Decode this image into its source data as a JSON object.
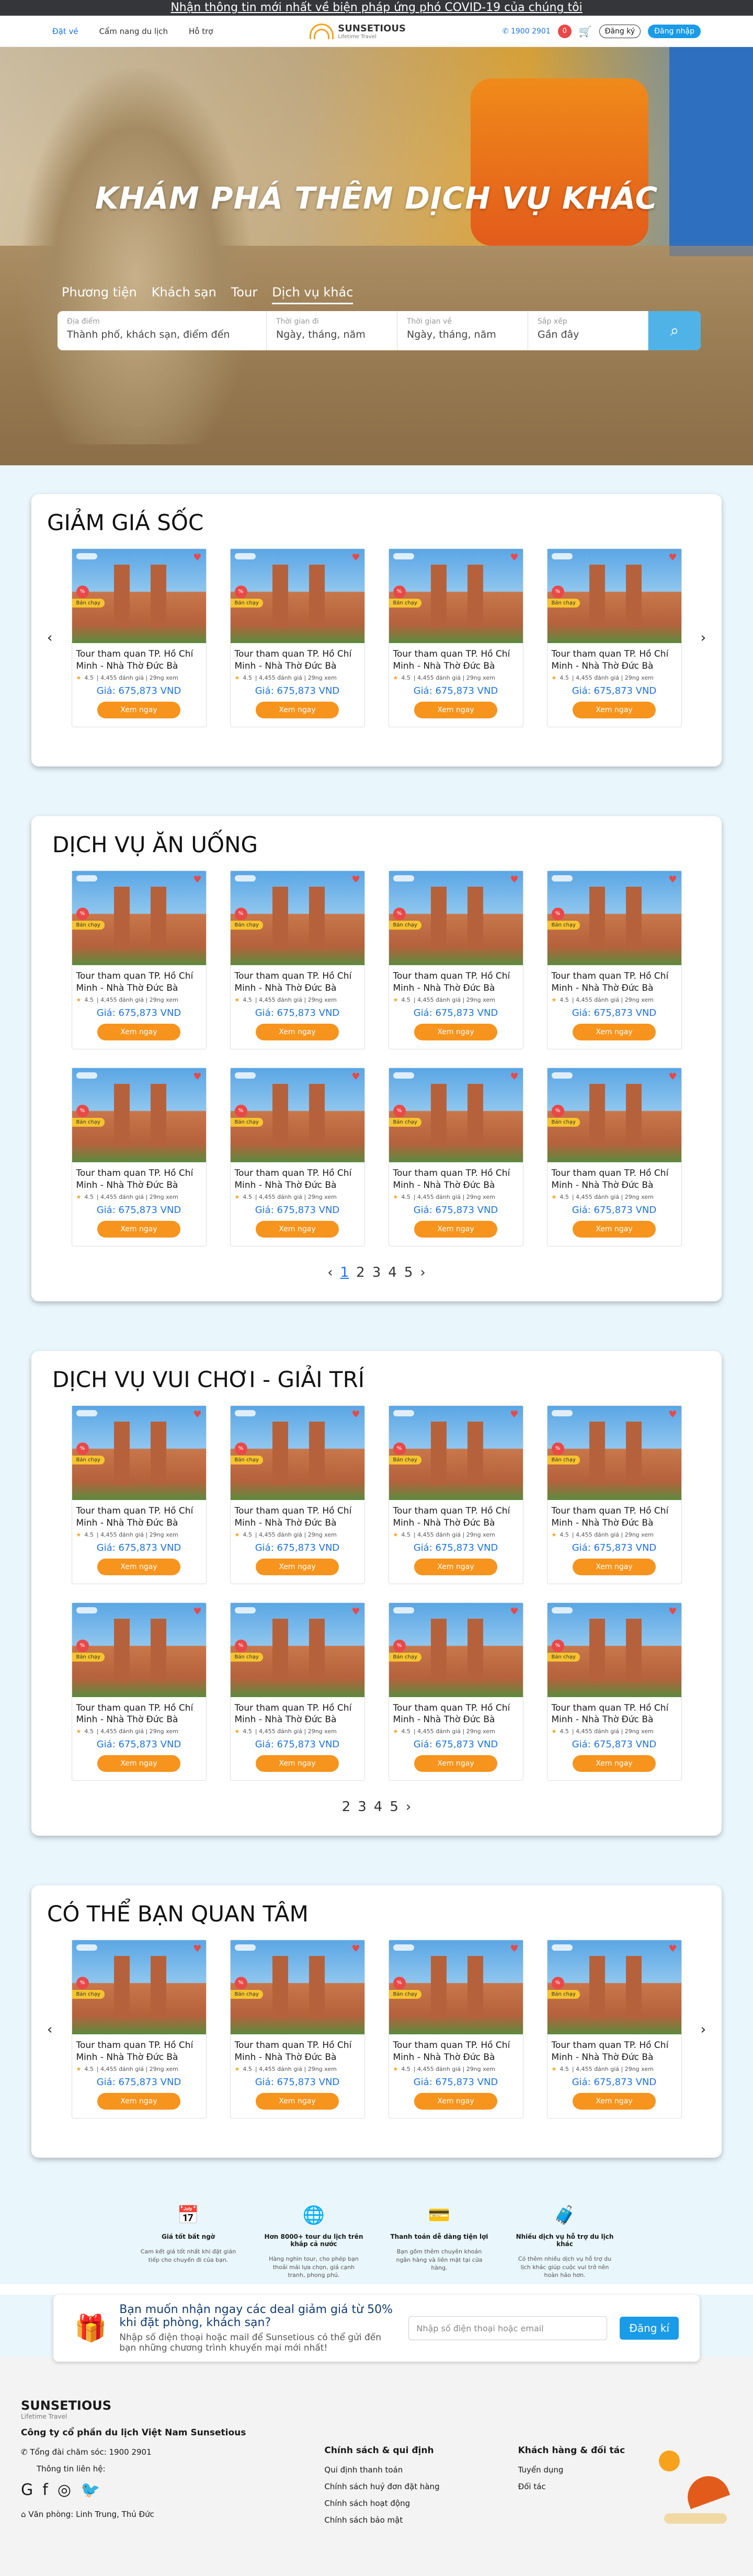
{
  "topbar": {
    "notice": "Nhận thông tin mới nhất về biện pháp ứng phó COVID-19 của chúng tôi"
  },
  "nav": {
    "links": [
      "Đặt vé",
      "Cẩm nang du lịch",
      "Hỗ trợ"
    ],
    "logo": "SUNSETIOUS",
    "logo_sub": "Lifetime Travel",
    "phone": "1900 2901",
    "badge": "0",
    "register": "Đăng ký",
    "login": "Đăng nhập"
  },
  "hero": {
    "title": "KHÁM PHÁ THÊM DỊCH VỤ KHÁC",
    "tabs": [
      "Phương tiện",
      "Khách sạn",
      "Tour",
      "Dịch vụ khác"
    ],
    "search": {
      "place_label": "Địa điểm",
      "place_ph": "Thành phố, khách sạn, điểm đến",
      "from_label": "Thời gian đi",
      "from_ph": "Ngày, tháng, năm",
      "to_label": "Thời gian về",
      "to_ph": "Ngày, tháng, năm",
      "sort_label": "Sắp xếp",
      "sort_val": "Gần đây"
    }
  },
  "card": {
    "title": "Tour tham quan TP. Hồ Chí Minh - Nhà Thờ Đức Bà",
    "rating": "4.5",
    "reviews": "| 4,455 đánh giá | 29ng xem",
    "price": "Giá: 675,873 VND",
    "button": "Xem ngay",
    "tag": "Bán chạy"
  },
  "sections": {
    "s1": "GIẢM GIÁ SỐC",
    "s2": "DỊCH VỤ ĂN UỐNG",
    "s3": "DỊCH VỤ VUI CHƠI - GIẢI TRÍ",
    "s4": "CÓ THỂ BẠN QUAN TÂM"
  },
  "pager": {
    "p1": "1",
    "p2": "2",
    "p3": "3",
    "p4": "4",
    "p5": "5"
  },
  "features": [
    {
      "title": "Giá tốt bất ngờ",
      "desc": "Cam kết giá tốt nhất khi đặt gián tiếp cho chuyến đi của bạn."
    },
    {
      "title": "Hơn 8000+ tour du lịch trên khắp cả nước",
      "desc": "Hàng nghìn tour, cho phép bạn thoải mái lựa chọn, giá cạnh tranh, phong phú."
    },
    {
      "title": "Thanh toán dễ dàng tiện lợi",
      "desc": "Bạn gồm thêm chuyên khoản ngân hàng và liên mặt tại cửa hàng."
    },
    {
      "title": "Nhiều dịch vụ hỗ trợ du lịch khác",
      "desc": "Có thêm nhiều dịch vụ hỗ trợ du lịch khác giúp cuộc vui trở nên hoàn hảo hơn."
    }
  ],
  "promo": {
    "headline": "Bạn muốn nhận ngay các deal giảm giá từ 50% khi đặt phòng, khách sạn?",
    "desc": "Nhập số điện thoại hoặc mail để Sunsetious có thể gửi đến bạn những chương trình khuyến mại mới nhất!",
    "placeholder": "Nhập số điện thoại hoặc email",
    "button": "Đăng kí"
  },
  "footer": {
    "logo": "SUNSETIOUS",
    "logo_sub": "Lifetime Travel",
    "company": "Công ty cổ phần du lịch Việt Nam Sunsetious",
    "hotline": "Tổng đài chăm sóc: 1900 2901",
    "contact": "Thông tin liên hệ:",
    "address": "Văn phòng: Linh Trung, Thủ Đức",
    "col2_title": "Chính sách & qui định",
    "col2": [
      "Qui định thanh toán",
      "Chính sách huỷ đơn đặt hàng",
      "Chính sách hoạt động",
      "Chính sách bảo mật"
    ],
    "col3_title": "Khách hàng & đối tác",
    "col3": [
      "Tuyển dụng",
      "Đối tác"
    ]
  }
}
